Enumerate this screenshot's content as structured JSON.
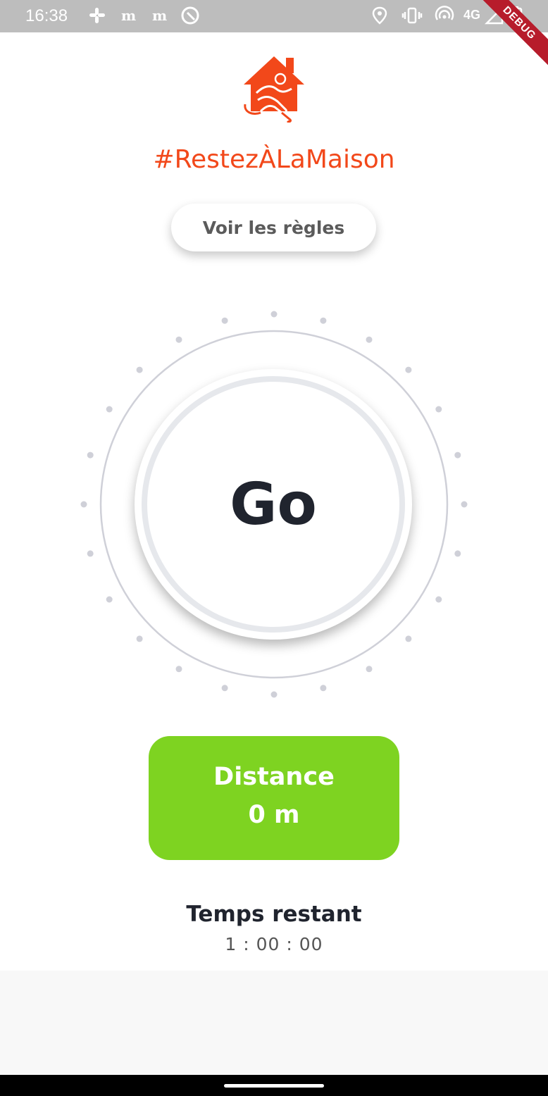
{
  "status_bar": {
    "time": "16:38",
    "network": "4G",
    "left_icons": [
      "slack-icon",
      "le-monde-icon",
      "le-monde-icon",
      "q-icon"
    ],
    "right_icons": [
      "location-icon",
      "vibrate-icon",
      "hotspot-icon",
      "signal-icon",
      "battery-icon"
    ],
    "debug_banner": "DEBUG"
  },
  "header": {
    "logo_icon": "house-runner-logo-icon",
    "title": "#RestezÀLaMaison",
    "accent_color": "#f2481a"
  },
  "rules_button": {
    "label": "Voir les règles"
  },
  "dial": {
    "go_label": "Go",
    "tick_count": 24
  },
  "distance_card": {
    "title": "Distance",
    "value": "0 m",
    "color": "#7ed321"
  },
  "timer": {
    "title": "Temps restant",
    "value": "1 : 00 : 00"
  }
}
